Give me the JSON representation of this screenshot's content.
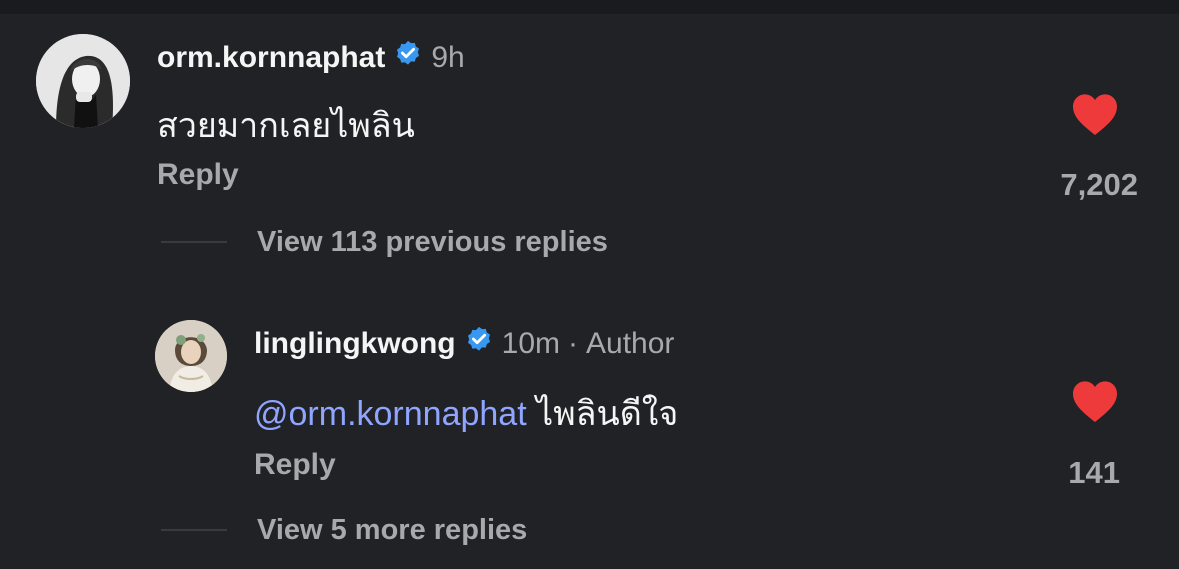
{
  "comments": [
    {
      "username": "orm.kornnaphat",
      "verified": true,
      "time": "9h",
      "text": "สวยมากเลยไพลิน",
      "reply_label": "Reply",
      "likes": "7,202",
      "liked": true,
      "heart_color": "#ee3a3a"
    },
    {
      "username": "linglingkwong",
      "verified": true,
      "time": "10m",
      "separator": "·",
      "badge": "Author",
      "mention": "@orm.kornnaphat",
      "text": "ไพลินดีใจ",
      "reply_label": "Reply",
      "likes": "141",
      "liked": true,
      "heart_color": "#ee3a3a"
    }
  ],
  "view_previous_replies": "View 113 previous replies",
  "view_more_replies": "View 5 more replies",
  "colors": {
    "background": "#212226",
    "verified_blue": "#3897f0",
    "mention": "#8fa5ff",
    "secondary_text": "#a8a8ad"
  }
}
